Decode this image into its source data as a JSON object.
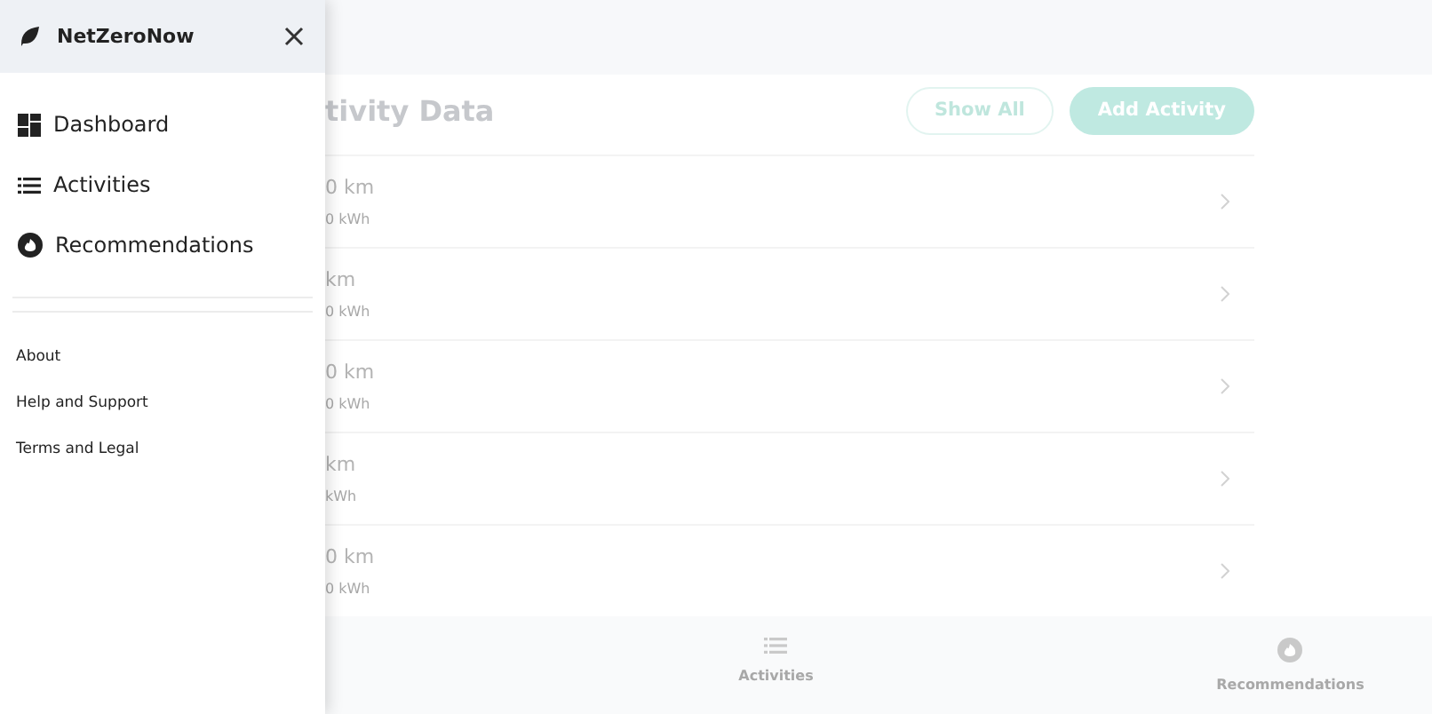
{
  "drawer": {
    "brand": "NetZeroNow",
    "nav": [
      {
        "label": "Dashboard",
        "kind": "dashboard"
      },
      {
        "label": "Activities",
        "kind": "list"
      },
      {
        "label": "Recommendations",
        "kind": "recommend"
      }
    ],
    "links": [
      "About",
      "Help and Support",
      "Terms and Legal"
    ]
  },
  "page": {
    "title": "tivity Data",
    "buttons": [
      {
        "label": "Show All",
        "kind": "outline"
      },
      {
        "label": "Add Activity",
        "kind": "filled"
      }
    ],
    "rows": [
      {
        "distance": "0 km",
        "energy": "0 kWh"
      },
      {
        "distance": "km",
        "energy": "0 kWh"
      },
      {
        "distance": "0 km",
        "energy": "0 kWh"
      },
      {
        "distance": "km",
        "energy": "kWh"
      },
      {
        "distance": "0 km",
        "energy": "0 kWh"
      }
    ]
  },
  "bottom_nav": [
    {
      "label": "Activities",
      "kind": "list"
    },
    {
      "label": "Recommendations",
      "kind": "recommend"
    }
  ]
}
